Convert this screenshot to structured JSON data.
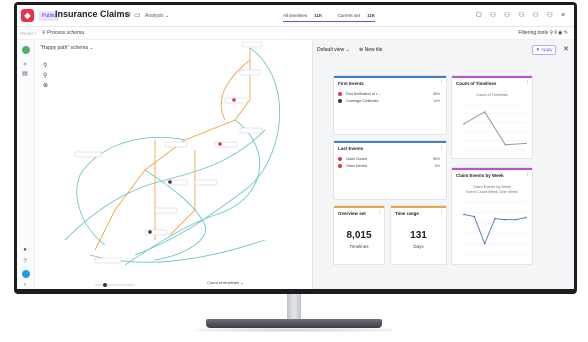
{
  "topbar": {
    "badge": "Public",
    "title": "Insurance Claims",
    "analysis_label": "Analysis",
    "all_timelines_label": "All timelines",
    "all_timelines_value": "11K",
    "current_set_label": "Current set",
    "current_set_value": "11K",
    "colors": {
      "logo": "#e8344b",
      "accent": "#6b4ee6"
    }
  },
  "subbar": {
    "project_label": "PROJECT",
    "process_schema_label": "Process schema",
    "filtering_tools_label": "Filtering tools"
  },
  "map": {
    "schema_label": "\"Happy path\" schema",
    "count_timelines_label": "Count of timelines"
  },
  "dashboard": {
    "default_view_label": "Default view",
    "new_tile_label": "New tile",
    "apply_label": "Apply",
    "first_events": {
      "title": "First Events",
      "rows": [
        {
          "label": "First Notification of L...",
          "pct": "86%",
          "color": "#e8344b"
        },
        {
          "label": "Coverage Confirmed",
          "pct": "14%",
          "color": "#3b3b3b"
        }
      ]
    },
    "last_events": {
      "title": "Last Events",
      "rows": [
        {
          "label": "Claim Closed",
          "pct": "88%",
          "color": "#e8344b"
        },
        {
          "label": "Claim Denied",
          "pct": "6%",
          "color": "#e8344b"
        }
      ]
    },
    "count_of_timelines": {
      "title": "Count of Timelines",
      "chart_title": "Count of Timelines",
      "accent": "#c24fd3"
    },
    "claim_events_by_week": {
      "title": "Claim Events by Week",
      "chart_title": "Claim Events by Week",
      "chart_subtitle": "Event Count Week Over Week",
      "accent": "#c24fd3"
    },
    "overview_set": {
      "title": "Overview set",
      "value": "8,015",
      "unit": "Timelines",
      "accent": "#e8a64b"
    },
    "time_range": {
      "title": "Time range",
      "value": "131",
      "unit": "Days",
      "accent": "#e8a64b"
    }
  },
  "chart_data": [
    {
      "type": "line",
      "title": "Count of Timelines",
      "x": [
        1,
        2,
        3,
        4
      ],
      "values": [
        40,
        58,
        8,
        10
      ],
      "ylim": [
        0,
        70
      ],
      "grid": true
    },
    {
      "type": "line",
      "title": "Claim Events by Week",
      "x": [
        1,
        2,
        3,
        4,
        5,
        6,
        7
      ],
      "values": [
        38,
        36,
        10,
        34,
        33,
        33,
        35
      ],
      "ylim": [
        0,
        50
      ],
      "grid": true
    }
  ]
}
